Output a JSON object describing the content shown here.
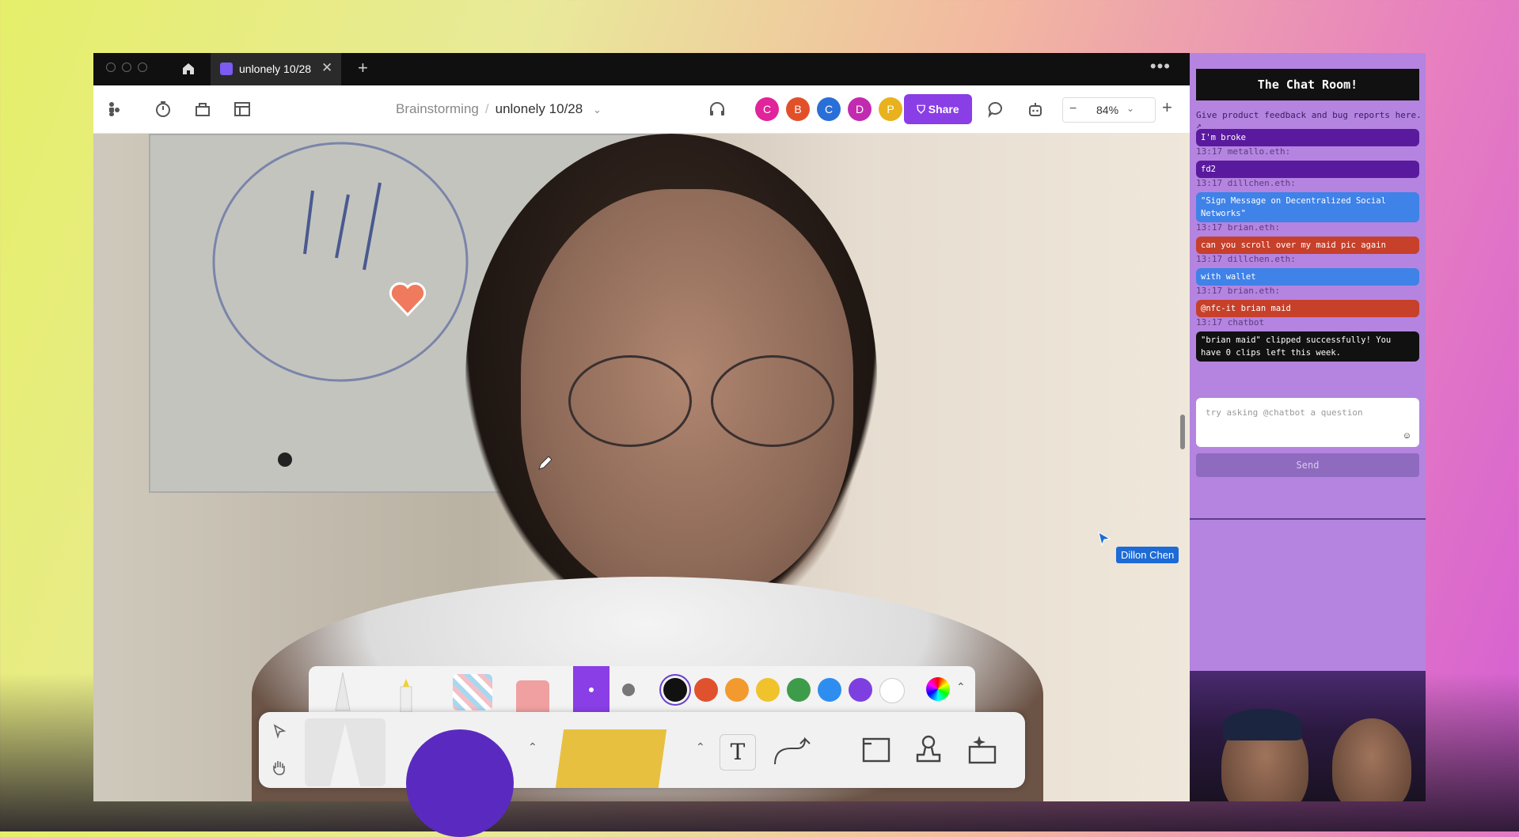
{
  "tabbar": {
    "file_tab": "unlonely 10/28",
    "close": "✕",
    "new_tab": "+",
    "menu": "•••"
  },
  "toolbar": {
    "breadcrumb": {
      "parent": "Brainstorming",
      "separator": "/",
      "current": "unlonely 10/28"
    },
    "avatars": [
      {
        "letter": "C",
        "color": "#e0249a"
      },
      {
        "letter": "B",
        "color": "#e2502a"
      },
      {
        "letter": "C",
        "color": "#2a6fd8"
      },
      {
        "letter": "D",
        "color": "#c22ab0"
      },
      {
        "letter": "P",
        "color": "#e8b21c"
      }
    ],
    "share_label": "Share",
    "zoom": "84%",
    "zoom_minus": "−",
    "zoom_plus": "+"
  },
  "canvas": {
    "cursor_user": "Dillon Chen",
    "help": "?"
  },
  "colors": {
    "swatches": [
      "#111111",
      "#e0512e",
      "#f29a2e",
      "#f0c22c",
      "#3d9c4a",
      "#2d8ef0",
      "#7d3fe0",
      "#ffffff"
    ],
    "accent": "#8a3ee6"
  },
  "chat": {
    "title": "The Chat Room!",
    "feedback_link": "Give product feedback and bug reports here.",
    "messages": [
      {
        "meta": "",
        "text": "I'm broke",
        "color": "#5a1a9e"
      },
      {
        "meta": "13:17  metallo.eth:",
        "text": "fd2",
        "color": "#5a1a9e"
      },
      {
        "meta": "13:17  dillchen.eth:",
        "text": "\"Sign Message on Decentralized Social Networks\"",
        "color": "#3f82e8"
      },
      {
        "meta": "13:17  brian.eth:",
        "text": "can you scroll over my maid pic again",
        "color": "#c7402a"
      },
      {
        "meta": "13:17  dillchen.eth:",
        "text": "with wallet",
        "color": "#3f82e8"
      },
      {
        "meta": "13:17  brian.eth:",
        "text": "@nfc-it brian maid",
        "color": "#c7402a"
      },
      {
        "meta": "13:17  chatbot",
        "text": "\"brian maid\" clipped successfully! You have 0 clips left this week.",
        "color": "#111111"
      }
    ],
    "input_placeholder": "try asking @chatbot a question",
    "send_label": "Send"
  }
}
